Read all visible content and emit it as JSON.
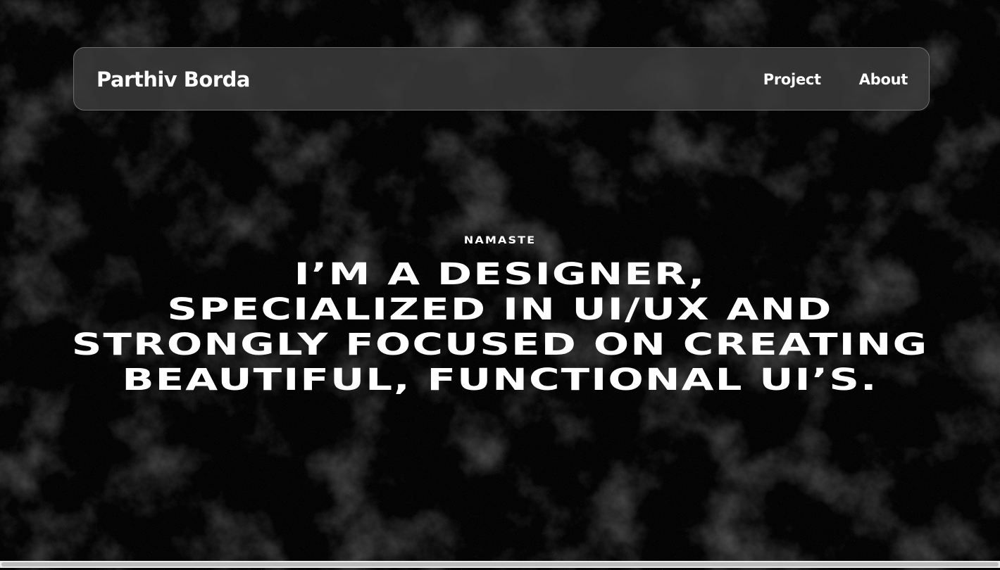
{
  "nav": {
    "brand": "Parthiv Borda",
    "links": [
      "Project",
      "About"
    ]
  },
  "hero": {
    "greeting": "NAMASTE",
    "headline_lines": [
      "I’M A DESIGNER,",
      "SPECIALIZED IN UI/UX AND",
      "STRONGLY FOCUSED ON CREATING",
      "BEAUTIFUL, FUNCTIONAL UI’S."
    ]
  },
  "colors": {
    "background": "#040404",
    "navbar_bg": "#3a3a3a",
    "navbar_border": "#6c6c6c",
    "text": "#ffffff"
  },
  "scrollbar": {
    "horizontal_visible_fraction": 1.0
  }
}
